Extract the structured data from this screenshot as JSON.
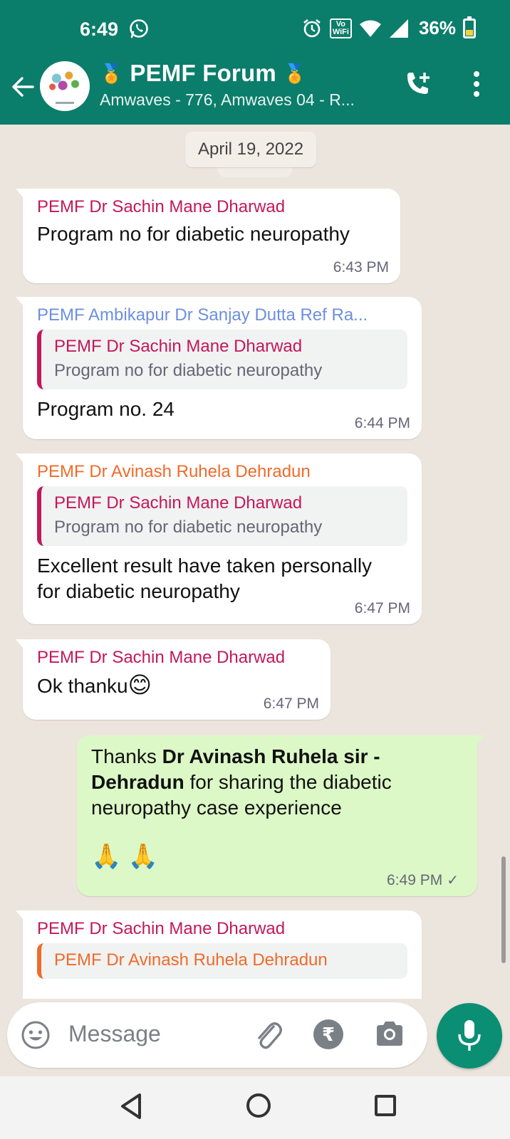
{
  "status_bar": {
    "time": "6:49",
    "battery_percent": "36%",
    "vowifi_label_top": "Vo",
    "vowifi_label_bottom": "WiFi",
    "icons": [
      "whatsapp-icon",
      "alarm-icon",
      "vowifi-icon",
      "wifi-icon",
      "signal-icon",
      "battery-icon"
    ]
  },
  "header": {
    "title": "PEMF Forum",
    "title_emoji_left": "🏅",
    "title_emoji_right": "🏅",
    "subtitle": "Amwaves - 776, Amwaves 04 - R...",
    "icons": [
      "back-arrow-icon",
      "add-call-icon",
      "more-vert-icon"
    ]
  },
  "chat": {
    "date_chip": "April 19, 2022",
    "messages": [
      {
        "direction": "in",
        "sender": "PEMF Dr Sachin Mane Dharwad",
        "sender_color": "#c2185b",
        "text": "Program no for diabetic neuropathy",
        "time": "6:43 PM"
      },
      {
        "direction": "in",
        "sender": "PEMF Ambikapur Dr Sanjay Dutta Ref Ra...",
        "sender_color": "#6d8fe0",
        "quote": {
          "sender": "PEMF Dr Sachin Mane Dharwad",
          "text": "Program no for diabetic neuropathy"
        },
        "text": "Program no. 24",
        "time": "6:44 PM"
      },
      {
        "direction": "in",
        "sender": "PEMF Dr Avinash Ruhela Dehradun",
        "sender_color": "#ef6b2a",
        "quote": {
          "sender": "PEMF Dr Sachin Mane Dharwad",
          "text": "Program no for diabetic neuropathy"
        },
        "text_line1": "Excellent result have taken personally",
        "text_line2": "for diabetic neuropathy",
        "time": "6:47 PM"
      },
      {
        "direction": "in",
        "sender": "PEMF Dr Sachin Mane Dharwad",
        "sender_color": "#c2185b",
        "text": "Ok thanku",
        "emoji": "😊",
        "time": "6:47 PM"
      },
      {
        "direction": "out",
        "text_prefix": "Thanks ",
        "text_bold": "Dr Avinash Ruhela sir - Dehradun",
        "text_suffix": " for sharing the diabetic neuropathy case experience",
        "emoji": "🙏 🙏",
        "time": "6:49 PM",
        "status": "✓"
      },
      {
        "direction": "in",
        "sender": "PEMF Dr Sachin Mane Dharwad",
        "sender_color": "#c2185b",
        "quote": {
          "sender": "PEMF Dr Avinash Ruhela Dehradun"
        }
      }
    ]
  },
  "composer": {
    "placeholder": "Message",
    "rupee_symbol": "₹",
    "icons": [
      "emoji-icon",
      "attach-icon",
      "payment-rupee-icon",
      "camera-icon",
      "mic-icon"
    ]
  },
  "navbar": {
    "icons": [
      "nav-back-icon",
      "nav-home-icon",
      "nav-recents-icon"
    ]
  },
  "colors": {
    "brand_green": "#0b7d6b",
    "outgoing_bubble": "#dcf8c6",
    "chat_bg": "#ece5dd",
    "mic_button": "#0b8f74"
  }
}
